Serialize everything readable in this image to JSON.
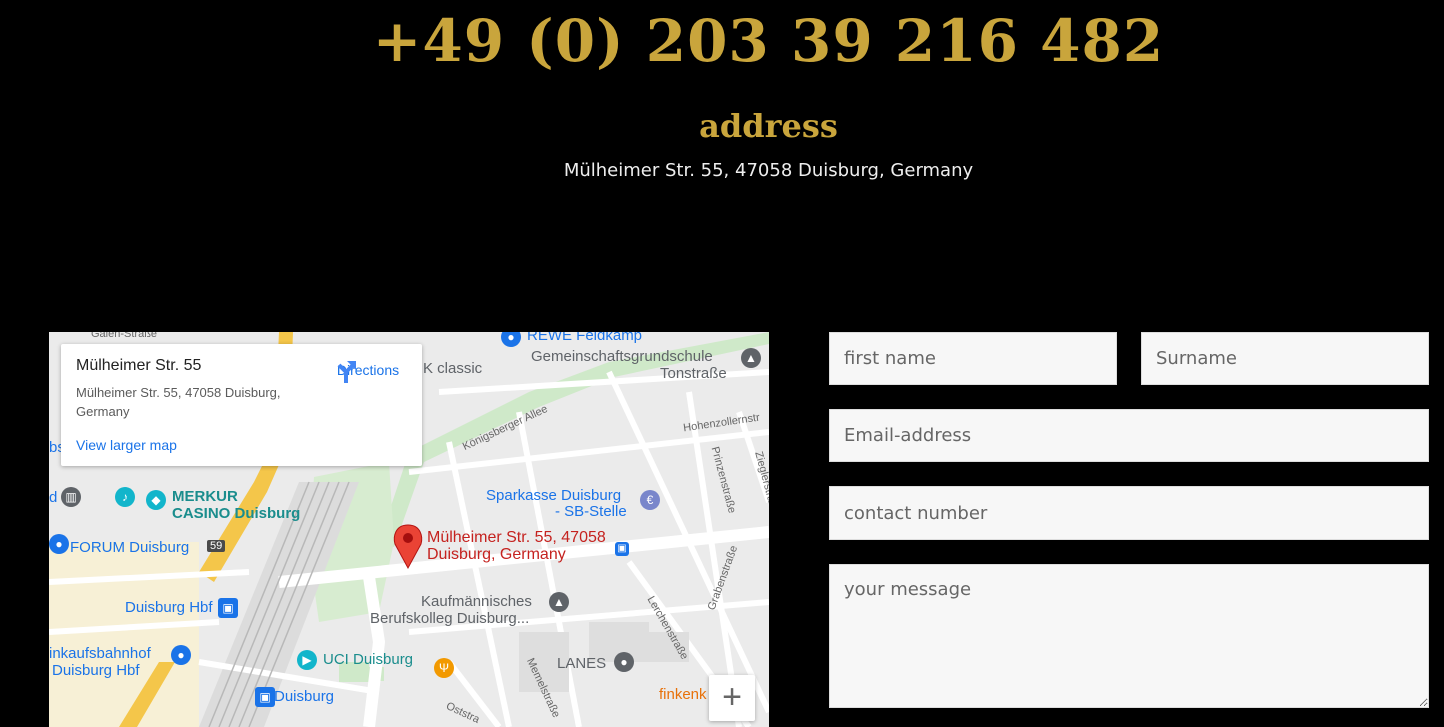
{
  "contact": {
    "phone": "+49 (0) 203 39 216 482",
    "address_title": "address",
    "address_text": "Mülheimer Str. 55, 47058 Duisburg, Germany"
  },
  "map": {
    "card_title": "Mülheimer Str. 55",
    "card_address": "Mülheimer Str. 55, 47058 Duisburg, Germany",
    "directions_label": "Directions",
    "larger_map_link": "View larger map",
    "zoom_in": "+",
    "labels": {
      "rewe": "REWE Feldkamp",
      "school": "Gemeinschaftsgrundschule",
      "school2": "Tonstraße",
      "classic": "K classic",
      "koenigsberger": "Königsberger Allee",
      "hohenzollern": "Hohenzollernstr",
      "prinzen": "Prinzenstraße",
      "ziegler": "Zieglerstraße",
      "sparkasse1": "Sparkasse Duisburg",
      "sparkasse2": "- SB-Stelle",
      "merkur1": "MERKUR",
      "merkur2": "CASINO Duisburg",
      "forum": "FORUM Duisburg",
      "route59": "59",
      "marker1": "Mülheimer Str. 55, 47058",
      "marker2": "Duisburg, Germany",
      "graben": "Grabenstraße",
      "hbf": "Duisburg Hbf",
      "kaufm1": "Kaufmännisches",
      "kaufm2": "Berufskolleg Duisburg...",
      "lerchen": "Lerchenstraße",
      "einkauf1": "inkaufsbahnhof",
      "einkauf2": "Duisburg Hbf",
      "uci": "UCI Duisburg",
      "lanes": "LANES",
      "memel": "Memelstraße",
      "duisburg": "Duisburg",
      "finken": "finkenk",
      "galen": "Galen-Straße",
      "bs": "bs",
      "d": "d",
      "ost": "Oststra"
    }
  },
  "form": {
    "first_name_placeholder": "first name",
    "surname_placeholder": "Surname",
    "email_placeholder": "Email-address",
    "phone_placeholder": "contact number",
    "message_placeholder": "your message"
  }
}
